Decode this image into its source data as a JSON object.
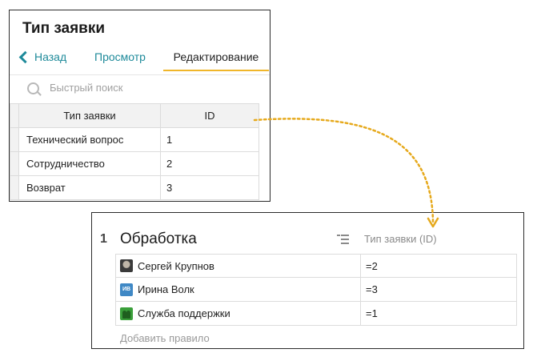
{
  "panel_top": {
    "title": "Тип заявки",
    "tabs": {
      "back": "Назад",
      "view": "Просмотр",
      "edit": "Редактирование"
    },
    "search": {
      "placeholder": "Быстрый поиск"
    },
    "table": {
      "headers": [
        "Тип заявки",
        "ID"
      ],
      "rows": [
        [
          "Технический вопрос",
          "1"
        ],
        [
          "Сотрудничество",
          "2"
        ],
        [
          "Возврат",
          "3"
        ]
      ]
    }
  },
  "panel_bottom": {
    "number": "1",
    "title": "Обработка",
    "column_label": "Тип заявки (ID)",
    "rules": [
      {
        "name": "Сергей Крупнов",
        "avatar": "user-photo",
        "value": "=2"
      },
      {
        "name": "Ирина Волк",
        "avatar": "initials",
        "initials": "ИВ",
        "value": "=3"
      },
      {
        "name": "Служба поддержки",
        "avatar": "group-icon",
        "value": "=1"
      }
    ],
    "add_rule": "Добавить правило"
  },
  "colors": {
    "accent_link": "#1e8a9a",
    "tab_underline": "#f0b62a",
    "connector": "#e6a91c"
  }
}
